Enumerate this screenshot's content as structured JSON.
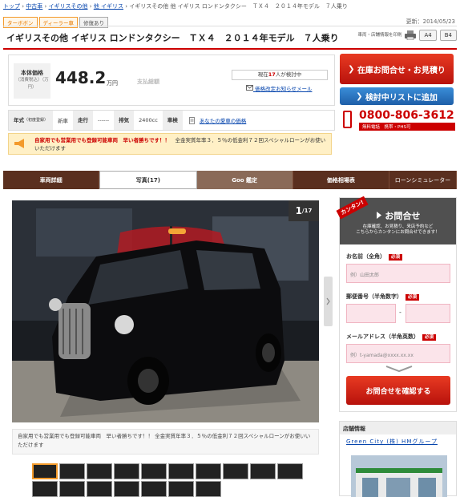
{
  "breadcrumb": [
    {
      "label": "トップ",
      "link": true
    },
    {
      "label": "中古車",
      "link": true
    },
    {
      "label": "イギリスその他",
      "link": true
    },
    {
      "label": "他 イギリス",
      "link": true
    },
    {
      "label": "イギリスその他 他 イギリス ロンドンタクシー　ＴＸ４　２０１４年モデル　７人乗り",
      "link": false
    }
  ],
  "tags": [
    "ターボボン",
    "ディーラー車",
    "修復あり"
  ],
  "updated": "更新：2014/05/23",
  "title": "イギリスその他 イギリス ロンドンタクシー　ＴＸ４　２０１４年モデル　７人乗り",
  "print": {
    "label": "車両・店舗情報を印刷",
    "a4": "A4",
    "b4": "B4"
  },
  "price": {
    "label": "本体価格",
    "sublabel": "（消費税込）（万円）",
    "value": "448.2",
    "unit": "万円",
    "total_label": "支払総額"
  },
  "viewing": {
    "prefix": "現在",
    "count": "17",
    "suffix": "人が検討中"
  },
  "mail_note": "価格改定お知らせメール",
  "specs": {
    "year_label": "年式",
    "year_sub": "（初度登録）",
    "year_value": "新車",
    "mileage_label": "走行",
    "mileage_value": "------",
    "engine_label": "排気",
    "engine_value": "2400cc",
    "inspection_label": "車検",
    "link": "あなたの愛車の価格"
  },
  "notice": {
    "bold": "自家用でも営業用でも登録可能車両　早い者勝ちです！！",
    "text": "全金実質年率３．５％の低金利７２回スペシャルローンがお使いいただけます"
  },
  "cta": {
    "inquiry": "在庫お問合せ・お見積り",
    "wishlist": "検討中リストに追加"
  },
  "phone": {
    "number": "0800-806-3612",
    "caption": "無料電話　携帯・PHS可"
  },
  "tabs": [
    "車両詳細",
    "写真(17)",
    "Goo 鑑定",
    "価格相場表",
    "ローンシミュレーター"
  ],
  "photo_counter": {
    "current": "1",
    "total": "/17"
  },
  "caption": "自家用でも営業用でも登録可能車両　早い者勝ちです！！ 全金実質年率３．５％の低金利７２回スペシャルローンがお使いいただけます",
  "form": {
    "ribbon": "カンタン!",
    "title": "お問合せ",
    "subtitle": "在庫確認、お見積り、来店予約など\nこちらからカンタンにお問合せできます！",
    "name_label": "お名前（全角）",
    "name_placeholder": "例）山田太郎",
    "zip_label": "郵便番号（半角数字）",
    "zip_sep": "-",
    "email_label": "メールアドレス（半角英数）",
    "email_placeholder": "例）t-yamada@xxxx.xx.xx",
    "required": "必須",
    "confirm": "お問合せを確認する"
  },
  "store": {
    "header": "店舗情報",
    "name": "Green City (株) HMグループ"
  },
  "colors": {
    "brand_red": "#c00",
    "tab_brown": "#5a2f1f",
    "cta_blue": "#1e5fa8"
  }
}
